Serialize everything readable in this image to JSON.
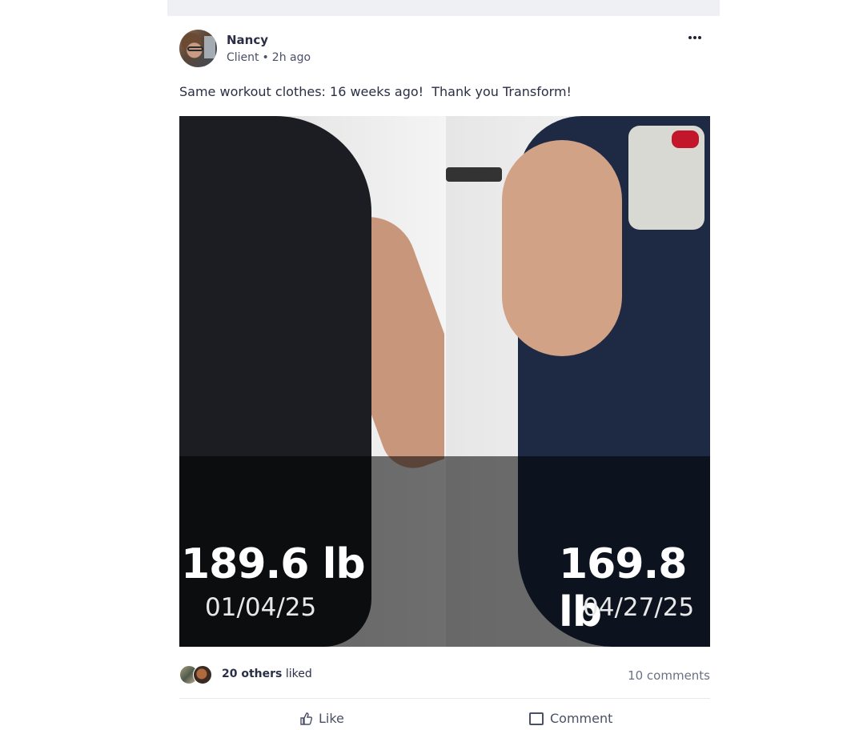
{
  "post": {
    "author": "Nancy",
    "role": "Client",
    "separator": "•",
    "time": "2h ago",
    "caption": "Same workout clothes: 16 weeks ago!  Thank you Transform!",
    "photo": {
      "left": {
        "weight": "189.6 lb",
        "date": "01/04/25"
      },
      "right": {
        "weight": "169.8 lb",
        "date": "04/27/25"
      }
    },
    "likes": {
      "count_text": "20 others",
      "suffix": " liked"
    },
    "comments_text": "10 comments",
    "actions": {
      "like_label": "Like",
      "comment_label": "Comment"
    }
  },
  "icons": {
    "more": "more-dots-icon",
    "like": "thumbs-up-icon",
    "comment": "comment-icon"
  }
}
